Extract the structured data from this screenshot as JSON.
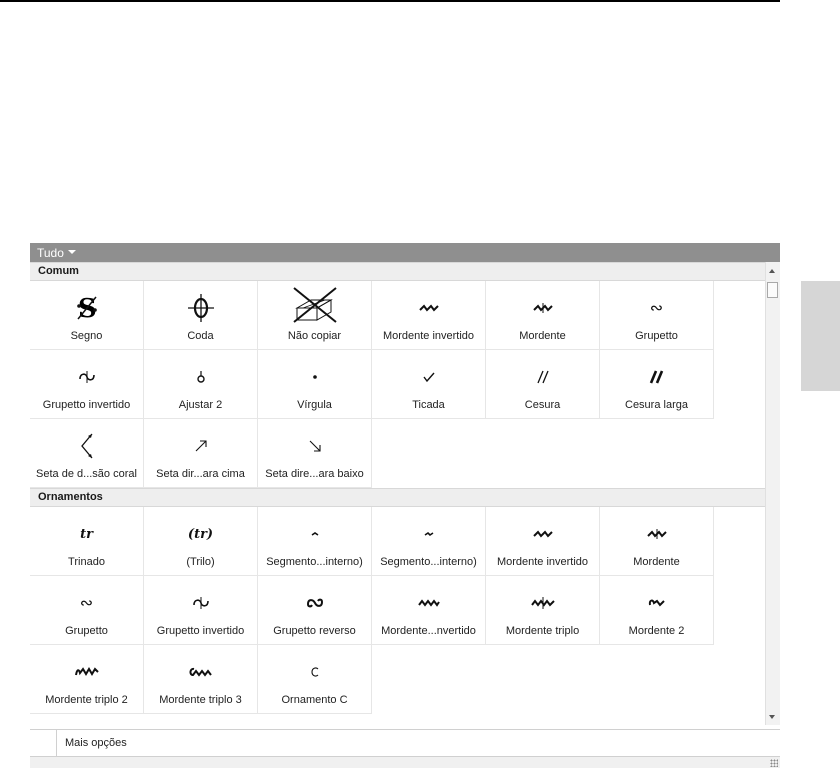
{
  "palette": {
    "title": "Tudo",
    "sections": [
      {
        "title": "Comum",
        "items": [
          {
            "label": "Segno",
            "icon": "segno-icon",
            "glyph": "𝄋"
          },
          {
            "label": "Coda",
            "icon": "coda-icon",
            "glyph": "𝄌"
          },
          {
            "label": "Não copiar",
            "icon": "no-copy-icon",
            "glyph": ""
          },
          {
            "label": "Mordente invertido",
            "icon": "inverted-mordent-icon",
            "glyph": "⩚"
          },
          {
            "label": "Mordente",
            "icon": "mordent-icon",
            "glyph": "⩚"
          },
          {
            "label": "Grupetto",
            "icon": "turn-icon",
            "glyph": "∾"
          },
          {
            "label": "Grupetto invertido",
            "icon": "inverted-turn-icon",
            "glyph": "∾"
          },
          {
            "label": "Ajustar 2",
            "icon": "adjust-icon",
            "glyph": "ȸ"
          },
          {
            "label": "Vírgula",
            "icon": "comma-icon",
            "glyph": "•"
          },
          {
            "label": "Ticada",
            "icon": "tick-icon",
            "glyph": "✓"
          },
          {
            "label": "Cesura",
            "icon": "caesura-icon",
            "glyph": "//"
          },
          {
            "label": "Cesura larga",
            "icon": "thick-caesura-icon",
            "glyph": "//"
          },
          {
            "label": "Seta de d...são coral",
            "icon": "divisi-arrow-icon",
            "glyph": "〈"
          },
          {
            "label": "Seta dir...ara cima",
            "icon": "arrow-up-right-icon",
            "glyph": "↗"
          },
          {
            "label": "Seta dire...ara baixo",
            "icon": "arrow-down-right-icon",
            "glyph": "↘"
          }
        ]
      },
      {
        "title": "Ornamentos",
        "items": [
          {
            "label": "Trinado",
            "icon": "trill-icon",
            "glyph": "tr"
          },
          {
            "label": "(Trilo)",
            "icon": "trill-parenthesized-icon",
            "glyph": "(tr)"
          },
          {
            "label": "Segmento...interno)",
            "icon": "segment-short-icon",
            "glyph": "⁀"
          },
          {
            "label": "Segmento...interno)",
            "icon": "segment-long-icon",
            "glyph": "~"
          },
          {
            "label": "Mordente invertido",
            "icon": "inverted-mordent-icon",
            "glyph": "⩚"
          },
          {
            "label": "Mordente",
            "icon": "mordent-icon",
            "glyph": "⩚"
          },
          {
            "label": "Grupetto",
            "icon": "turn-icon",
            "glyph": "∾"
          },
          {
            "label": "Grupetto invertido",
            "icon": "inverted-turn-icon",
            "glyph": "∾"
          },
          {
            "label": "Grupetto reverso",
            "icon": "reverse-turn-icon",
            "glyph": "∽"
          },
          {
            "label": "Mordente...nvertido",
            "icon": "long-inverted-mordent-icon",
            "glyph": "⩚⩚"
          },
          {
            "label": "Mordente triplo",
            "icon": "triple-mordent-icon",
            "glyph": "⩚⩚"
          },
          {
            "label": "Mordente 2",
            "icon": "mordent-2-icon",
            "glyph": "∿"
          },
          {
            "label": "Mordente triplo 2",
            "icon": "triple-mordent-2-icon",
            "glyph": "⩚⩚"
          },
          {
            "label": "Mordente triplo 3",
            "icon": "triple-mordent-3-icon",
            "glyph": "⩚⩚"
          },
          {
            "label": "Ornamento C",
            "icon": "ornament-c-icon",
            "glyph": "c"
          }
        ]
      }
    ],
    "footer": {
      "more_options": "Mais opções"
    }
  }
}
